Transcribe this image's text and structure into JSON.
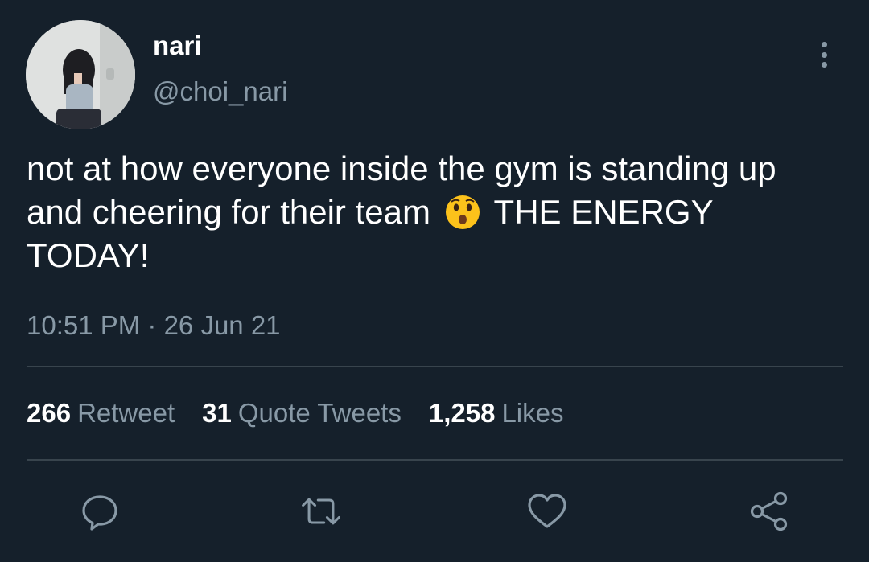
{
  "tweet": {
    "author": {
      "display_name": "nari",
      "handle": "@choi_nari",
      "avatar_icon": "profile-photo"
    },
    "text_part1": "not at how everyone inside the gym is standing up and cheering for their team",
    "emoji": "hushed-face-emoji",
    "text_part2": "THE ENERGY TODAY!",
    "timestamp": "10:51 PM · 26 Jun 21",
    "stats": {
      "retweets": {
        "count": "266",
        "label": "Retweet"
      },
      "quotes": {
        "count": "31",
        "label": "Quote Tweets"
      },
      "likes": {
        "count": "1,258",
        "label": "Likes"
      }
    },
    "actions": [
      "reply-icon",
      "retweet-icon",
      "like-icon",
      "share-icon"
    ]
  },
  "theme": {
    "background": "#15202b",
    "secondary_text": "#8899a6",
    "divider": "#38444d",
    "primary_text": "#ffffff"
  }
}
